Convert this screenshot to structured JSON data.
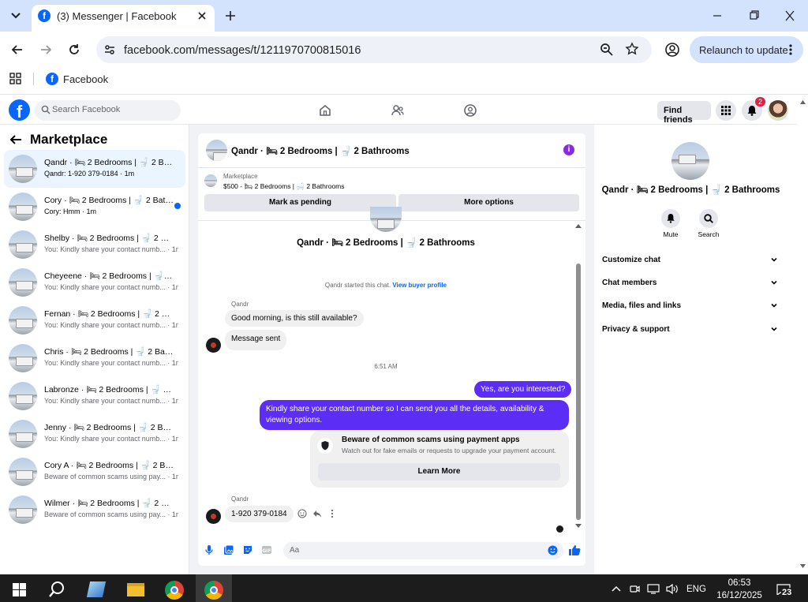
{
  "browser": {
    "tab_title": "(3) Messenger | Facebook",
    "url": "facebook.com/messages/t/1211970700815016",
    "relaunch_label": "Relaunch to update",
    "bookmark_label": "Facebook"
  },
  "fb": {
    "search_placeholder": "Search Facebook",
    "find_friends": "Find friends",
    "notif_count": "2"
  },
  "left": {
    "title": "Marketplace",
    "conversations": [
      {
        "name": "Qandr · 🛏 2 Bedrooms | 🚽 2 Bathrooms",
        "preview": "Qandr: 1-920 379-0184 · 1m",
        "time": ""
      },
      {
        "name": "Cory · 🛏 2 Bedrooms | 🚽 2 Bathrooms",
        "preview": "Cory: Hmm · 1m",
        "time": ""
      },
      {
        "name": "Shelby · 🛏 2 Bedrooms | 🚽 2 Bathrooms",
        "preview": "You: Kindly share your contact numb...",
        "time": "· 1m"
      },
      {
        "name": "Cheyeene · 🛏 2 Bedrooms | 🚽 2 Bathrooms",
        "preview": "You: Kindly share your contact numb...",
        "time": "· 1m"
      },
      {
        "name": "Fernan · 🛏 2 Bedrooms | 🚽 2 Bathrooms",
        "preview": "You: Kindly share your contact numb...",
        "time": "· 1m"
      },
      {
        "name": "Chris · 🛏 2 Bedrooms | 🚽 2 Bathrooms",
        "preview": "You: Kindly share your contact numb...",
        "time": "· 1m"
      },
      {
        "name": "Labronze · 🛏 2 Bedrooms | 🚽 2 Bathrooms",
        "preview": "You: Kindly share your contact numb...",
        "time": "· 1m"
      },
      {
        "name": "Jenny · 🛏 2 Bedrooms | 🚽 2 Bathrooms",
        "preview": "You: Kindly share your contact numb...",
        "time": "· 1m"
      },
      {
        "name": "Cory A · 🛏 2 Bedrooms | 🚽 2 Bathrooms",
        "preview": "Beware of common scams using pay...",
        "time": "· 1m"
      },
      {
        "name": "Wilmer · 🛏 2 Bedrooms | 🚽 2 Bathrooms",
        "preview": "Beware of common scams using pay...",
        "time": "· 1m"
      }
    ]
  },
  "chat": {
    "title": "Qandr · 🛏 2 Bedrooms | 🚽 2 Bathrooms",
    "marketplace_label": "Marketplace",
    "listing": "$500 - 🛏 2 Bedrooms | 🛁 2 Bathrooms",
    "mark_pending": "Mark as pending",
    "more_options": "More options",
    "started_text": "Qandr started this chat.",
    "view_profile": "View buyer profile",
    "sender": "Qandr",
    "msg1": "Good morning, is this still available?",
    "msg2": "Message sent",
    "time_sep": "6:51 AM",
    "out1": "Yes, are you interested?",
    "out2": "Kindly share your contact number so I can send you all the details, availability & viewing options.",
    "scam_title": "Beware of common scams using payment apps",
    "scam_desc": "Watch out for fake emails or requests to upgrade your payment account.",
    "learn_more": "Learn More",
    "msg3": "1-920 379-0184",
    "composer_placeholder": "Aa"
  },
  "right": {
    "title": "Qandr · 🛏 2 Bedrooms | 🚽 2 Bathrooms",
    "mute": "Mute",
    "search": "Search",
    "rows": [
      "Customize chat",
      "Chat members",
      "Media, files and links",
      "Privacy & support"
    ]
  },
  "taskbar": {
    "lang": "ENG",
    "time": "06:53",
    "date": "16/12/2025",
    "notif": "23"
  },
  "colors": {
    "fb_blue": "#0866ff",
    "accent_purple": "#5b2df5"
  }
}
